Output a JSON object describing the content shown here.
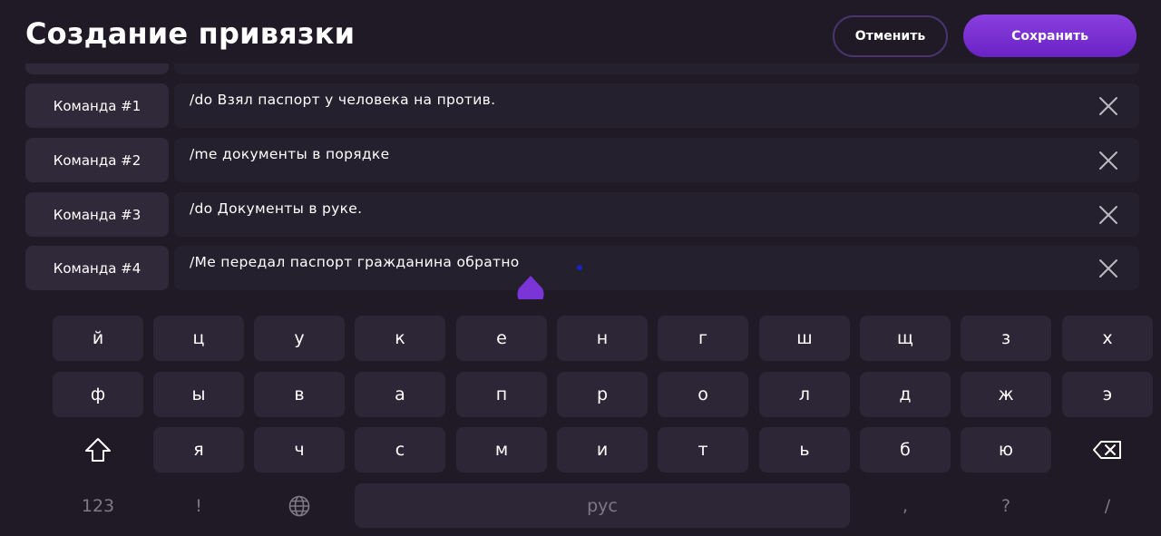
{
  "header": {
    "title": "Создание привязки",
    "cancel_label": "Отменить",
    "save_label": "Сохранить"
  },
  "commands": [
    {
      "label": "Команда #1",
      "value": "/do Взял паспорт у человека на против."
    },
    {
      "label": "Команда #2",
      "value": "/me документы в порядке"
    },
    {
      "label": "Команда #3",
      "value": "/do Документы в руке."
    },
    {
      "label": "Команда #4",
      "value": "/Me передал паспорт гражданина обратно"
    }
  ],
  "keyboard": {
    "row1": [
      "й",
      "ц",
      "у",
      "к",
      "е",
      "н",
      "г",
      "ш",
      "щ",
      "з",
      "х"
    ],
    "row2": [
      "ф",
      "ы",
      "в",
      "а",
      "п",
      "р",
      "о",
      "л",
      "д",
      "ж",
      "э"
    ],
    "row3": [
      "я",
      "ч",
      "с",
      "м",
      "и",
      "т",
      "ь",
      "б",
      "ю"
    ],
    "numbers_label": "123",
    "exclaim_label": "!",
    "space_label": "рус",
    "comma_label": ",",
    "question_label": "?",
    "slash_label": "/"
  },
  "icons": {
    "clear": "close-icon",
    "shift": "shift-icon",
    "backspace": "backspace-icon",
    "language": "globe-icon"
  },
  "colors": {
    "background": "#1f1a26",
    "accent": "#7b35d6",
    "key": "#2d2636"
  }
}
